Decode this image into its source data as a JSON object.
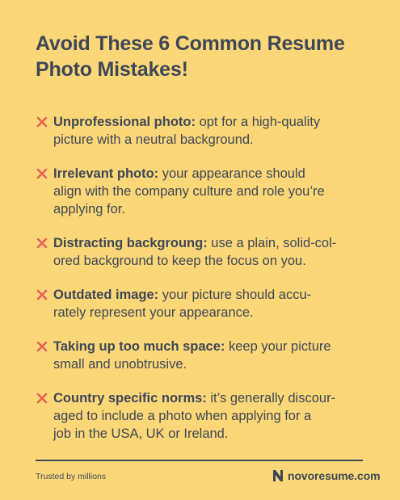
{
  "title": {
    "line1": "Avoid These 6 Common Resume",
    "line2": "Photo Mistakes!"
  },
  "colors": {
    "background": "#fcd778",
    "text": "#3d4757",
    "accent_x": "#e8615a"
  },
  "items": [
    {
      "icon": "x-mark-icon",
      "lead": "Unprofessional photo:",
      "lines": [
        " opt for a high-quality",
        "picture with a neutral background."
      ]
    },
    {
      "icon": "x-mark-icon",
      "lead": "Irrelevant photo:",
      "lines": [
        " your appearance should",
        "align with the company culture and role you’re",
        "applying for."
      ]
    },
    {
      "icon": "x-mark-icon",
      "lead": "Distracting backgroung:",
      "lines": [
        " use a plain, solid-col-",
        "ored background to keep the focus on you."
      ]
    },
    {
      "icon": "x-mark-icon",
      "lead": "Outdated image:",
      "lines": [
        " your picture should accu-",
        "rately represent your appearance."
      ]
    },
    {
      "icon": "x-mark-icon",
      "lead": "Taking up too much space:",
      "lines": [
        " keep your picture",
        "small and unobtrusive."
      ]
    },
    {
      "icon": "x-mark-icon",
      "lead": "Country specific norms:",
      "lines": [
        " it’s generally discour-",
        "aged to include a photo when applying for a",
        "job in the USA, UK or Ireland."
      ]
    }
  ],
  "footer": {
    "tagline": "Trusted by millions",
    "brand": "novoresume.com",
    "brand_icon": "novoresume-logo-icon"
  }
}
